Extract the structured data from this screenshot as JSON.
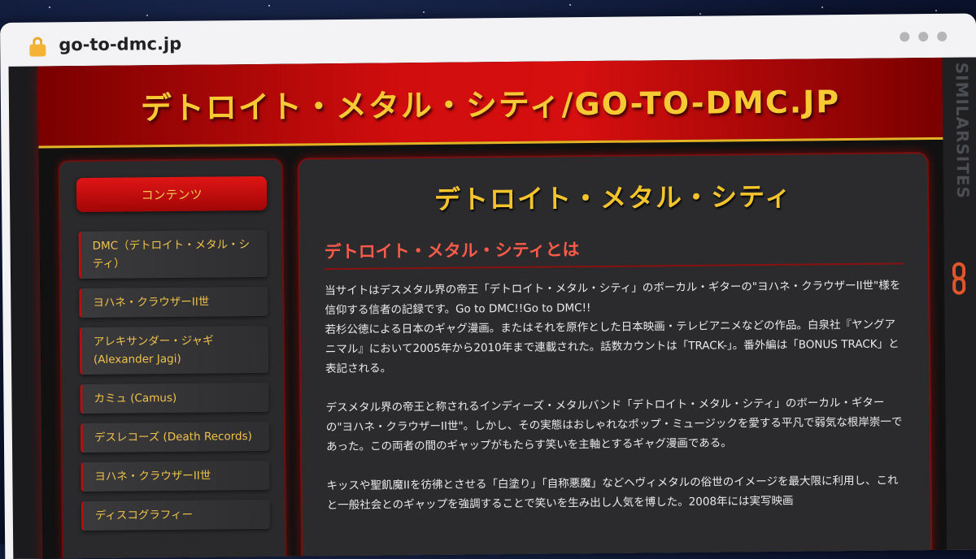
{
  "browser": {
    "url": "go-to-dmc.jp",
    "lock_icon": "lock-icon",
    "menu_icon": "more-dots-icon"
  },
  "site": {
    "title": "デトロイト・メタル・シティ/GO-TO-DMC.JP"
  },
  "sidebar": {
    "heading": "コンテンツ",
    "items": [
      {
        "label": "DMC（デトロイト・メタル・シティ）"
      },
      {
        "label": "ヨハネ・クラウザーII世"
      },
      {
        "label": "アレキサンダー・ジャギ (Alexander Jagi)"
      },
      {
        "label": "カミュ (Camus)"
      },
      {
        "label": "デスレコーズ (Death Records)"
      },
      {
        "label": "ヨハネ・クラウザーII世"
      },
      {
        "label": "ディスコグラフィー"
      }
    ]
  },
  "main": {
    "title": "デトロイト・メタル・シティ",
    "section_title": "デトロイト・メタル・シティとは",
    "paragraphs": [
      "当サイトはデスメタル界の帝王「デトロイト・メタル・シティ」のボーカル・ギターの\"ヨハネ・クラウザーII世\"様を信仰する信者の記録です。Go to DMC!!Go to DMC!!",
      "若杉公徳による日本のギャグ漫画。またはそれを原作とした日本映画・テレビアニメなどの作品。白泉社『ヤングアニマル』において2005年から2010年まで連載された。話数カウントは「TRACK-」。番外編は「BONUS TRACK」と表記される。",
      "デスメタル界の帝王と称されるインディーズ・メタルバンド「デトロイト・メタル・シティ」のボーカル・ギターの\"ヨハネ・クラウザーII世\"。しかし、その実態はおしゃれなポップ・ミュージックを愛する平凡で弱気な根岸崇一であった。この両者の間のギャップがもたらす笑いを主軸とするギャグ漫画である。",
      "キッスや聖飢魔IIを彷彿とさせる「白塗り」「自称悪魔」などヘヴィメタルの俗世のイメージを最大限に利用し、これと一般社会とのギャップを強調することで笑いを生み出し人気を博した。2008年には実写映画"
    ]
  },
  "side_strip": {
    "vertical_text": "SIMILARSITES",
    "chain_icon": "link-icon"
  },
  "colors": {
    "accent_gold": "#f4c42c",
    "header_red": "#d10d0d",
    "section_red": "#ff5a4a"
  }
}
